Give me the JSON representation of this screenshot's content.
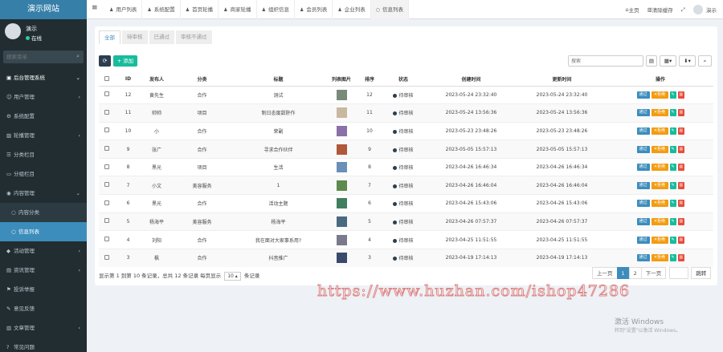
{
  "app": {
    "brand": "演示网站"
  },
  "user": {
    "name": "演示",
    "status": "在线"
  },
  "sidebar_search": {
    "placeholder": "搜索菜单"
  },
  "sidebar": {
    "items": [
      {
        "label": "后台管理系统",
        "icon": "dashboard-icon",
        "type": "header",
        "chevron": "⌄"
      },
      {
        "label": "用户管理",
        "icon": "user-icon",
        "type": "normal",
        "chevron": "‹"
      },
      {
        "label": "系统配置",
        "icon": "cog-icon",
        "type": "normal",
        "chevron": ""
      },
      {
        "label": "轮播管理",
        "icon": "image-icon",
        "type": "normal",
        "chevron": "‹"
      },
      {
        "label": "分类栏目",
        "icon": "list-icon",
        "type": "normal",
        "chevron": ""
      },
      {
        "label": "分组栏目",
        "icon": "folder-icon",
        "type": "normal",
        "chevron": ""
      },
      {
        "label": "内容管理",
        "icon": "file-icon",
        "type": "normal",
        "chevron": "⌄"
      },
      {
        "label": "内容分类",
        "icon": "circle-icon",
        "type": "sub",
        "chevron": ""
      },
      {
        "label": "信息列表",
        "icon": "circle-icon",
        "type": "sub-active",
        "chevron": ""
      },
      {
        "label": "活动管理",
        "icon": "tag-icon",
        "type": "normal",
        "chevron": "‹"
      },
      {
        "label": "资讯管理",
        "icon": "newspaper-icon",
        "type": "normal",
        "chevron": "‹"
      },
      {
        "label": "投诉举报",
        "icon": "flag-icon",
        "type": "normal",
        "chevron": ""
      },
      {
        "label": "意见反馈",
        "icon": "comment-icon",
        "type": "normal",
        "chevron": ""
      },
      {
        "label": "文章管理",
        "icon": "book-icon",
        "type": "normal",
        "chevron": "‹"
      },
      {
        "label": "常见问题",
        "icon": "question-icon",
        "type": "normal",
        "chevron": ""
      }
    ]
  },
  "topbar": {
    "tabs": [
      {
        "label": "用户列表",
        "active": false
      },
      {
        "label": "系统配置",
        "active": false
      },
      {
        "label": "首页轮播",
        "active": false
      },
      {
        "label": "商家轮播",
        "active": false
      },
      {
        "label": "组织信息",
        "active": false
      },
      {
        "label": "会员列表",
        "active": false
      },
      {
        "label": "企业列表",
        "active": false
      },
      {
        "label": "信息列表",
        "active": true
      }
    ],
    "right": [
      {
        "label": "主页",
        "icon": "home-icon"
      },
      {
        "label": "清除缓存",
        "icon": "trash-icon"
      },
      {
        "label": "",
        "icon": "fullscreen-icon"
      },
      {
        "label": "演示",
        "icon": "avatar"
      }
    ]
  },
  "panel_tabs": [
    {
      "label": "全部",
      "active": true
    },
    {
      "label": "待审核",
      "active": false
    },
    {
      "label": "已通过",
      "active": false
    },
    {
      "label": "审核不通过",
      "active": false
    }
  ],
  "toolbar": {
    "add_label": "添加",
    "search_placeholder": "搜索"
  },
  "table": {
    "headers": [
      "",
      "ID",
      "发布人",
      "分类",
      "标题",
      "列表图片",
      "排序",
      "状态",
      "创建时间",
      "更新时间",
      "操作"
    ],
    "status_label": "待审核",
    "actions": {
      "pass": "通过",
      "reject": "拒绝"
    },
    "rows": [
      {
        "id": "12",
        "publisher": "黄先生",
        "category": "合作",
        "title": "测试",
        "sort": "12",
        "created": "2023-05-24 23:32:40",
        "updated": "2023-05-24 23:32:40",
        "thumb": "#7a8a7a"
      },
      {
        "id": "11",
        "publisher": "帅帅",
        "category": "项目",
        "title": "制日态度甜肝作",
        "sort": "11",
        "created": "2023-05-24 13:56:36",
        "updated": "2023-05-24 13:56:36",
        "thumb": "#c9b8a0"
      },
      {
        "id": "10",
        "publisher": "小",
        "category": "合作",
        "title": "荣副",
        "sort": "10",
        "created": "2023-05-23 23:48:26",
        "updated": "2023-05-23 23:48:26",
        "thumb": "#8a6fa8"
      },
      {
        "id": "9",
        "publisher": "张广",
        "category": "合作",
        "title": "寻求合作伙伴",
        "sort": "9",
        "created": "2023-05-05 15:57:13",
        "updated": "2023-05-05 15:57:13",
        "thumb": "#b0583a"
      },
      {
        "id": "8",
        "publisher": "黑光",
        "category": "项目",
        "title": "生活",
        "sort": "8",
        "created": "2023-04-26 16:46:34",
        "updated": "2023-04-26 16:46:34",
        "thumb": "#6a8fb8"
      },
      {
        "id": "7",
        "publisher": "小文",
        "category": "美容服务",
        "title": "1",
        "sort": "7",
        "created": "2023-04-26 16:46:04",
        "updated": "2023-04-26 16:46:04",
        "thumb": "#5e8a4e"
      },
      {
        "id": "6",
        "publisher": "黑光",
        "category": "合作",
        "title": "活动主题",
        "sort": "6",
        "created": "2023-04-26 15:43:06",
        "updated": "2023-04-26 15:43:06",
        "thumb": "#3f7f5f"
      },
      {
        "id": "5",
        "publisher": "杨海平",
        "category": "美容服务",
        "title": "杨海平",
        "sort": "5",
        "created": "2023-04-26 07:57:37",
        "updated": "2023-04-26 07:57:37",
        "thumb": "#4a6a80"
      },
      {
        "id": "4",
        "publisher": "刘阳",
        "category": "合作",
        "title": "我在面对大家事系用?",
        "sort": "4",
        "created": "2023-04-25 11:51:55",
        "updated": "2023-04-25 11:51:55",
        "thumb": "#7a7a8a"
      },
      {
        "id": "3",
        "publisher": "枫",
        "category": "合作",
        "title": "抖音推广",
        "sort": "3",
        "created": "2023-04-19 17:14:13",
        "updated": "2023-04-19 17:14:13",
        "thumb": "#3a4a6a"
      }
    ]
  },
  "pagination": {
    "info_prefix": "显示第 1 到第 10 条记录，总共 12 条记录 每页显示",
    "page_size": "10 ▴",
    "info_suffix": "条记录",
    "prev": "上一页",
    "pages": [
      "1",
      "2"
    ],
    "next": "下一页",
    "go": "跳转"
  },
  "watermark": "https://www.huzhan.com/ishop47286",
  "windows_activation": {
    "line1": "激活 Windows",
    "line2": "转到\"设置\"以激活 Windows。"
  }
}
